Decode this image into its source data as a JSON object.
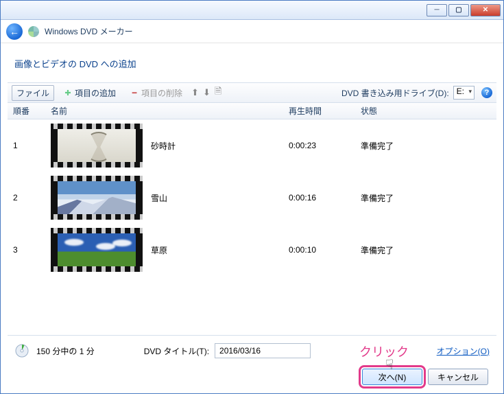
{
  "app_title": "Windows DVD メーカー",
  "page_heading": "画像とビデオの DVD への追加",
  "toolbar": {
    "file_label": "ファイル",
    "add_label": "項目の追加",
    "remove_label": "項目の削除",
    "drive_label": "DVD 書き込み用ドライブ(D):",
    "drive_value": "E:"
  },
  "columns": {
    "order": "順番",
    "name": "名前",
    "duration": "再生時間",
    "status": "状態"
  },
  "items": [
    {
      "order": "1",
      "name": "砂時計",
      "duration": "0:00:23",
      "status": "準備完了",
      "thumb": "hourglass"
    },
    {
      "order": "2",
      "name": "雪山",
      "duration": "0:00:16",
      "status": "準備完了",
      "thumb": "mountain"
    },
    {
      "order": "3",
      "name": "草原",
      "duration": "0:00:10",
      "status": "準備完了",
      "thumb": "grass"
    }
  ],
  "footer": {
    "progress": "150 分中の 1 分",
    "title_label": "DVD タイトル(T):",
    "title_value": "2016/03/16",
    "options_link": "オプション(O)"
  },
  "buttons": {
    "next": "次へ(N)",
    "cancel": "キャンセル"
  },
  "annotation": {
    "click_label": "クリック"
  }
}
